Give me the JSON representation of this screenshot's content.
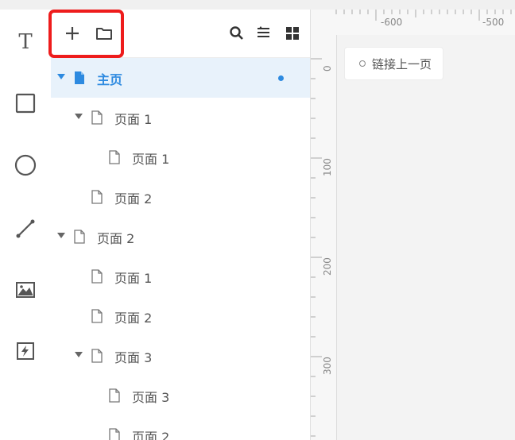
{
  "toolbar": {
    "tools": [
      {
        "name": "text-tool",
        "icon": "text-T-icon"
      },
      {
        "name": "rectangle-tool",
        "icon": "square-icon"
      },
      {
        "name": "circle-tool",
        "icon": "circle-icon"
      },
      {
        "name": "line-tool",
        "icon": "line-icon"
      },
      {
        "name": "image-tool",
        "icon": "image-icon"
      },
      {
        "name": "hotspot-tool",
        "icon": "lightning-icon"
      }
    ]
  },
  "panel": {
    "header": {
      "left_icons": [
        "plus-icon",
        "folder-icon"
      ],
      "right_icons": [
        "search-icon",
        "sort-icon",
        "grid-icon"
      ],
      "highlight_color": "#ee1c1c"
    },
    "tree": [
      {
        "label": "主页",
        "level": 0,
        "expanded": true,
        "selected": true,
        "has_dot": true
      },
      {
        "label": "页面 1",
        "level": 1,
        "expanded": true
      },
      {
        "label": "页面 1",
        "level": 2
      },
      {
        "label": "页面 2",
        "level": 1
      },
      {
        "label": "页面 2",
        "level": 0,
        "expanded": true
      },
      {
        "label": "页面 1",
        "level": 1
      },
      {
        "label": "页面 2",
        "level": 1
      },
      {
        "label": "页面 3",
        "level": 1,
        "expanded": true
      },
      {
        "label": "页面 3",
        "level": 2
      },
      {
        "label": "页面 2",
        "level": 2
      }
    ]
  },
  "canvas": {
    "ruler_h": [
      "-600",
      "-500"
    ],
    "ruler_v": [
      "0",
      "100",
      "200",
      "300"
    ],
    "link_chip": "链接上一页"
  },
  "colors": {
    "accent": "#2d8ae0",
    "selected_bg": "#e8f2fb"
  }
}
